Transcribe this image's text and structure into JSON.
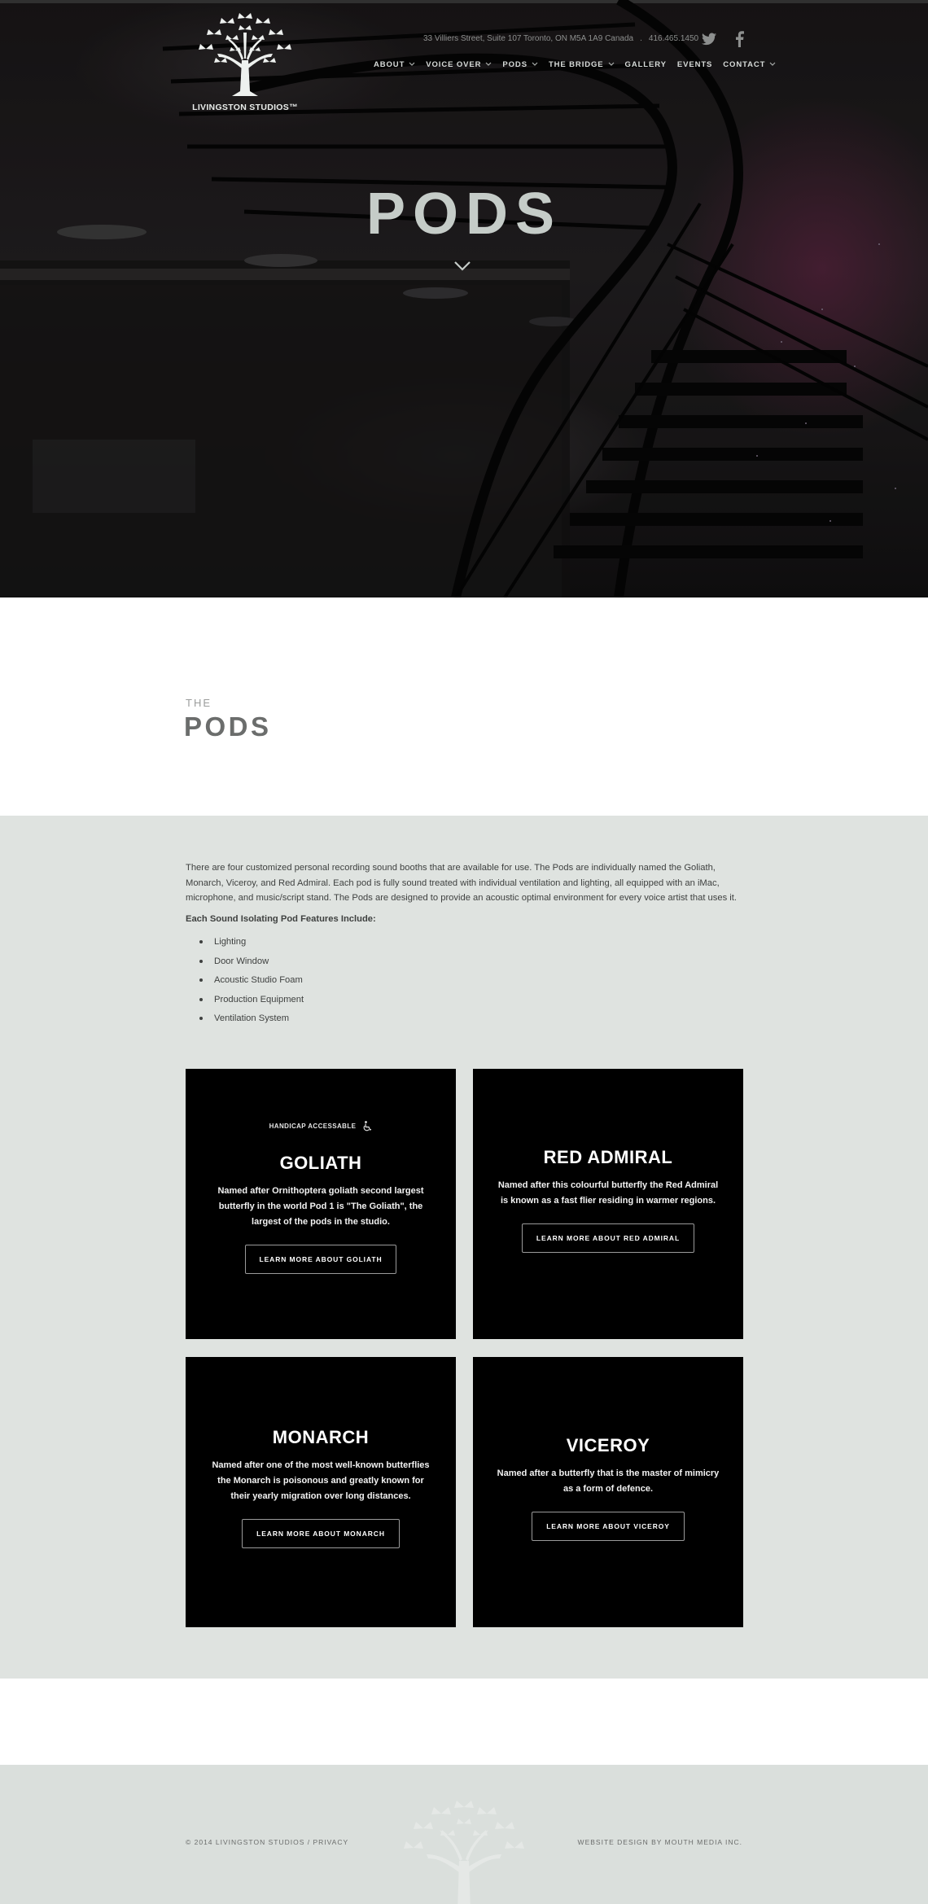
{
  "brand": {
    "logo_text": "LIVINGSTON STUDIOS™"
  },
  "header": {
    "address": "33 Villiers Street, Suite 107 Toronto, ON M5A 1A9 Canada",
    "separator": ".",
    "phone": "416.465.1450",
    "social": [
      "twitter-icon",
      "facebook-icon"
    ]
  },
  "nav": {
    "items": [
      {
        "label": "ABOUT",
        "dropdown": true
      },
      {
        "label": "VOICE OVER",
        "dropdown": true
      },
      {
        "label": "PODS",
        "dropdown": true
      },
      {
        "label": "THE BRIDGE",
        "dropdown": true
      },
      {
        "label": "GALLERY",
        "dropdown": false
      },
      {
        "label": "EVENTS",
        "dropdown": false
      },
      {
        "label": "CONTACT",
        "dropdown": true
      }
    ]
  },
  "hero": {
    "title": "PODS",
    "scroll_icon": "chevron-down-icon"
  },
  "intro": {
    "eyebrow": "THE",
    "heading": "PODS"
  },
  "content": {
    "description": "There are four customized personal recording sound booths that are available for use. The Pods are individually named the Goliath, Monarch, Viceroy, and Red Admiral. Each pod is fully sound treated with individual ventilation and lighting, all equipped with an iMac, microphone, and music/script stand. The Pods are designed to provide an acoustic optimal environment for every voice artist that uses it.",
    "features_title": "Each Sound Isolating Pod Features Include:",
    "features": [
      "Lighting",
      "Door Window",
      "Acoustic Studio Foam",
      "Production Equipment",
      "Ventilation System"
    ]
  },
  "pods": [
    {
      "badge": "HANDICAP ACCESSABLE",
      "title": "GOLIATH",
      "text": "Named after Ornithoptera goliath second largest butterfly in the world Pod 1 is \"The Goliath\", the largest of the pods in the studio.",
      "button": "LEARN MORE ABOUT GOLIATH"
    },
    {
      "title": "RED ADMIRAL",
      "text": "Named after this colourful butterfly the Red Admiral is known as a fast flier residing in warmer regions.",
      "button": "LEARN MORE ABOUT RED ADMIRAL"
    },
    {
      "title": "MONARCH",
      "text": "Named after one of the most well-known butterflies the Monarch is poisonous and greatly known for their yearly migration over long distances.",
      "button": "LEARN MORE ABOUT MONARCH"
    },
    {
      "title": "VICEROY",
      "text": "Named after a butterfly that is the master of mimicry as a form of defence.",
      "button": "LEARN MORE ABOUT VICEROY"
    }
  ],
  "footer": {
    "copyright": "© 2014 LIVINGSTON STUDIOS",
    "separator": " / ",
    "privacy": "PRIVACY",
    "credit": "WEBSITE DESIGN BY MOUTH MEDIA INC."
  },
  "colors": {
    "hero_title": "#c5ccc8",
    "content_bg": "#dfe3e0",
    "footer_bg": "#dadfdc",
    "card_bg": "#000000",
    "heading_gray": "#6b6d6c"
  }
}
